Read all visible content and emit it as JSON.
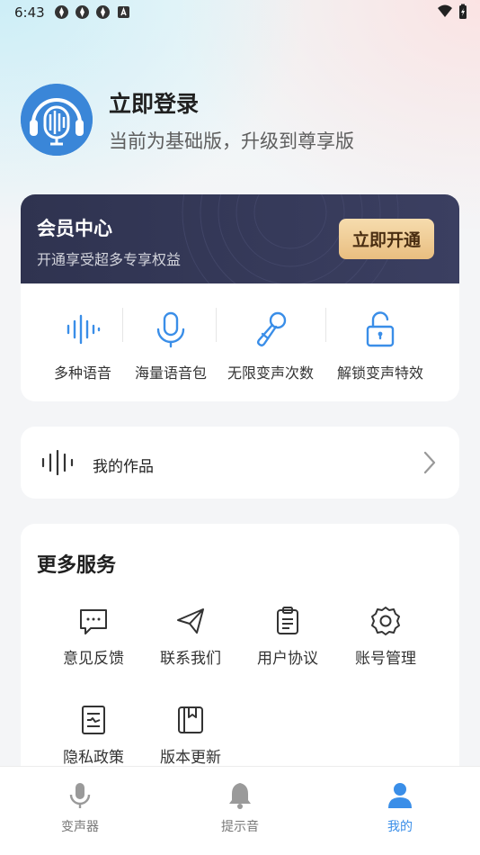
{
  "status_bar": {
    "time": "6:43",
    "battery_icon": "battery-charging-icon",
    "wifi_icon": "wifi-icon"
  },
  "profile": {
    "title": "立即登录",
    "subtitle": "当前为基础版，升级到尊享版"
  },
  "member": {
    "title": "会员中心",
    "subtitle": "开通享受超多专享权益",
    "button": "立即开通",
    "benefits": [
      {
        "label": "多种语音",
        "icon": "waveform-icon"
      },
      {
        "label": "海量语音包",
        "icon": "microphone-icon"
      },
      {
        "label": "无限变声次数",
        "icon": "karaoke-mic-icon"
      },
      {
        "label": "解锁变声特效",
        "icon": "unlock-icon"
      }
    ]
  },
  "works": {
    "label": "我的作品"
  },
  "services": {
    "title": "更多服务",
    "items": [
      {
        "label": "意见反馈",
        "icon": "chat-bubble-icon"
      },
      {
        "label": "联系我们",
        "icon": "send-icon"
      },
      {
        "label": "用户协议",
        "icon": "clipboard-icon"
      },
      {
        "label": "账号管理",
        "icon": "gear-icon"
      },
      {
        "label": "隐私政策",
        "icon": "document-icon"
      },
      {
        "label": "版本更新",
        "icon": "book-icon"
      }
    ]
  },
  "tabs": [
    {
      "label": "变声器",
      "icon": "microphone-icon",
      "active": false
    },
    {
      "label": "提示音",
      "icon": "bell-icon",
      "active": false
    },
    {
      "label": "我的",
      "icon": "user-icon",
      "active": true
    }
  ],
  "colors": {
    "accent": "#3a8ee8",
    "member_bg": "#2f3350",
    "gold_button": "#efcb94"
  }
}
